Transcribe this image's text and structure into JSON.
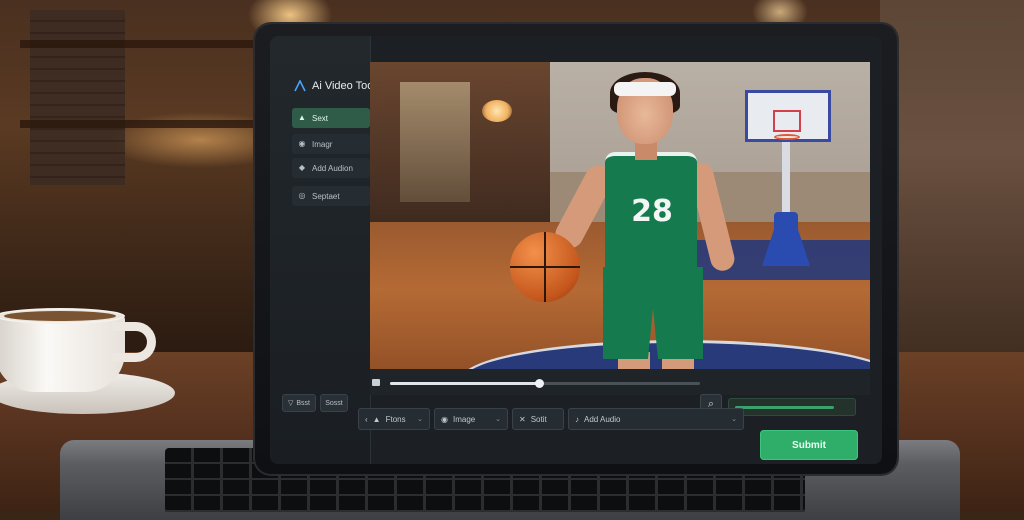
{
  "app": {
    "title": "Ai Video Tool"
  },
  "sidebar": {
    "items": [
      {
        "label": "Sext",
        "icon": "text-icon",
        "active": true
      },
      {
        "label": "Imagr",
        "icon": "image-icon",
        "active": false
      },
      {
        "label": "Add Audion",
        "icon": "audio-icon",
        "active": false
      },
      {
        "label": "Septaet",
        "icon": "settings-icon",
        "active": false
      }
    ],
    "bottom_buttons": [
      {
        "label": "Bsst",
        "icon": "filter-icon"
      },
      {
        "label": "Sosst",
        "icon": ""
      }
    ]
  },
  "video": {
    "jersey_number": "28",
    "playback_progress": 0.48
  },
  "controls": {
    "text_select": "Ftons",
    "image_select": "Image",
    "style_select": "Sotit",
    "audio_select": "Add Audio",
    "submit_label": "Submit",
    "render_progress": 0.85
  },
  "colors": {
    "accent_green": "#2fae6a",
    "active_nav": "#2e5c48",
    "screen_bg": "#1c2024"
  }
}
